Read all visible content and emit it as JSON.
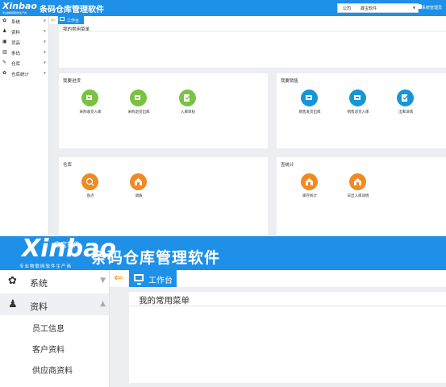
{
  "app": {
    "logo_text": "Xinbao",
    "logo_brand_cn": "鑫宝软件",
    "logo_tagline": "专业物联网软件生产商",
    "title": "条码仓库管理软件"
  },
  "header": {
    "company_label": "公司",
    "company_value": "鑫宝软件",
    "user_label": "系统管理员"
  },
  "sidebar": {
    "items": [
      {
        "label": "系统",
        "icon": "gear-icon"
      },
      {
        "label": "资料",
        "icon": "user-add-icon"
      },
      {
        "label": "货品",
        "icon": "box-icon"
      },
      {
        "label": "条码",
        "icon": "barcode-icon"
      },
      {
        "label": "仓库",
        "icon": "edit-icon"
      },
      {
        "label": "仓库统计",
        "icon": "gear-icon"
      }
    ],
    "sub_items": [
      "员工信息",
      "客户资料",
      "供应商资料"
    ]
  },
  "tabs": {
    "active": "工作台"
  },
  "favorites": {
    "title": "我的常用菜单"
  },
  "quick": {
    "purchase": {
      "title": "我要进货",
      "items": [
        "采购收货入库",
        "采购退货出库",
        "入库审核"
      ]
    },
    "sales": {
      "title": "我要销售",
      "items": [
        "销售发货出库",
        "销售退货入库",
        "出库详情"
      ]
    },
    "warehouse": {
      "title": "仓库",
      "items": [
        "盘点",
        "调拨"
      ]
    },
    "stats": {
      "title": "查统计",
      "items": [
        "库存统计",
        "日出入库详情"
      ]
    }
  },
  "colors": {
    "brand_blue": "#1e90e8",
    "green": "#7cc242",
    "blue_icon": "#1696d6",
    "orange": "#f08a24",
    "back_arrow": "#f29a1b"
  }
}
